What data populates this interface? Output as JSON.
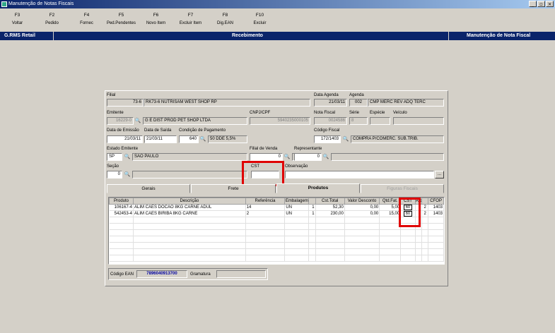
{
  "window": {
    "title": "Manutenção de Notas Fiscais",
    "controls": [
      "_",
      "▫",
      "×"
    ]
  },
  "toolbar": [
    {
      "key": "F3",
      "label": "Voltar"
    },
    {
      "key": "F2",
      "label": "Pedido"
    },
    {
      "key": "F4",
      "label": "Fornec"
    },
    {
      "key": "F5",
      "label": "Ped.Pendentes"
    },
    {
      "key": "F6",
      "label": "Novo Item"
    },
    {
      "key": "F7",
      "label": "Excluir Item"
    },
    {
      "key": "F8",
      "label": "Dig.EAN"
    },
    {
      "key": "F10",
      "label": "Excluir"
    }
  ],
  "bar": {
    "left": "G.RMS Retail",
    "center": "Recebimento",
    "right": "Manutenção de Nota Fiscal"
  },
  "form": {
    "filial_label": "Filial",
    "filial_code": "73-6",
    "filial_name": "RK73-6 NUTRISAM WEST SHOP RP",
    "data_agenda_label": "Data Agenda",
    "data_agenda": "21/03/11",
    "agenda_label": "Agenda",
    "agenda_code": "002",
    "agenda_desc": "CMP MERC REV ADQ TERC",
    "emitente_label": "Emitente",
    "emitente_code": "16229-0",
    "emitente_name": "G E DIST PROD PET SHOP LTDA",
    "cnpj_label": "CNPJ/CPF",
    "cnpj": "5940235000105",
    "nota_label": "Nota Fiscal",
    "nota": "0024586",
    "serie_label": "Série",
    "serie": "8",
    "especie_label": "Espécie",
    "veiculo_label": "Veículo",
    "emissao_label": "Data de Emissão",
    "emissao": "21/03/11",
    "saida_label": "Data de Saída",
    "saida": "21/03/11",
    "cond_label": "Condição de Pagamento",
    "cond_code": "640",
    "cond_desc": "50 DDE 5,5%",
    "cfiscal_label": "Código Fiscal",
    "cfiscal": "172/1403",
    "cfiscal_desc": "COMPRA P/COMERC. SUB.TRIB.",
    "estado_label": "Estado Emitente",
    "estado_uf": "SP",
    "estado_nome": "SAO PAULO",
    "filial_venda_label": "Filial de Venda",
    "filial_venda": "0",
    "representante_label": "Representante",
    "representante": "0",
    "secao_label": "Seção",
    "secao": "0",
    "cst_label": "CST",
    "cst": "",
    "obs_label": "Observação",
    "obs_btn": "...",
    "binoculars": "🔍"
  },
  "tabs": [
    {
      "label": "Gerais",
      "state": "normal"
    },
    {
      "label": "Frete",
      "state": "normal"
    },
    {
      "label": "Produtos",
      "state": "active"
    },
    {
      "label": "Figuras Fiscais",
      "state": "disabled"
    }
  ],
  "grid": {
    "headers": [
      "Produto",
      "Descrição",
      "Referência",
      "Embalagem",
      "",
      "Cst.Total",
      "Valor Desconto",
      "Qtd.Fat.",
      "CST",
      "Aliq",
      "",
      "CFOP"
    ],
    "rows": [
      [
        "106167-4",
        "ALIM CAES DOCAO 8KG CARNE ADUL",
        "14",
        "UN",
        "1",
        "52,30",
        "0,00",
        "5,00",
        "60",
        "",
        "2",
        "1403"
      ],
      [
        "542453-4",
        "ALIM CAES BIRIBA 8KG CARNE",
        "2",
        "UN",
        "1",
        "230,00",
        "0,00",
        "15,00",
        "60",
        "",
        "2",
        "1403"
      ]
    ]
  },
  "ean": {
    "label": "Código EAN",
    "value": "7896040913700",
    "gramatura_label": "Gramatura",
    "gramatura": ""
  },
  "colors": {
    "highlight": "#e00000",
    "bar": "#0a246a",
    "ean_text": "#0000a0"
  }
}
